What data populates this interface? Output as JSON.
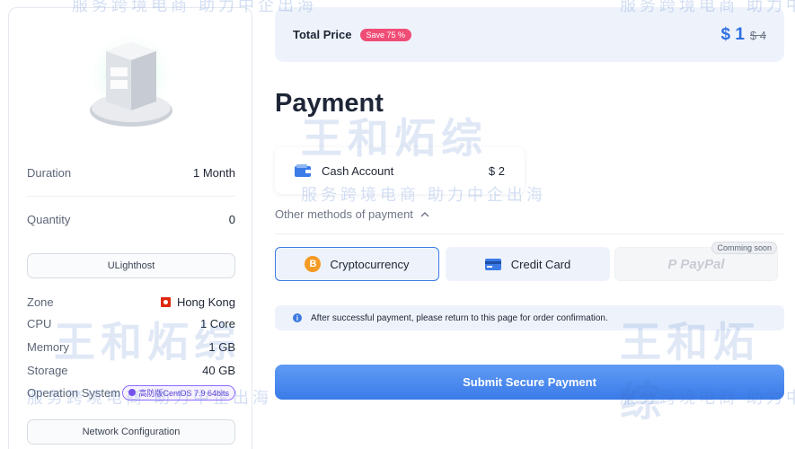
{
  "summary": {
    "rows": [
      {
        "label": "Duration",
        "value": "1 Month"
      },
      {
        "label": "Quantity",
        "value": "0"
      }
    ],
    "ulighthost_label": "ULighthost",
    "specs": [
      {
        "label": "Zone",
        "value": "Hong Kong"
      },
      {
        "label": "CPU",
        "value": "1 Core"
      },
      {
        "label": "Memory",
        "value": "1 GB"
      },
      {
        "label": "Storage",
        "value": "40 GB"
      },
      {
        "label": "Operation System",
        "value": "高防版CentOS 7.9 64bits"
      }
    ],
    "network_button": "Network Configuration"
  },
  "total": {
    "label": "Total Price",
    "badge": "Save 75 %",
    "price_new": "$ 1",
    "price_old": "$ 4"
  },
  "payment": {
    "title": "Payment",
    "cash_label": "Cash Account",
    "cash_amount": "$ 2",
    "other_methods": "Other methods of payment",
    "methods": [
      {
        "label": "Cryptocurrency"
      },
      {
        "label": "Credit Card"
      },
      {
        "label": "PayPal",
        "badge": "Comming soon"
      }
    ],
    "notice": "After successful payment, please return to this page for order confirmation.",
    "submit": "Submit Secure Payment"
  },
  "watermark": {
    "tagline": "服务跨境电商 助力中企出海",
    "brand": "王和炻综"
  },
  "colors": {
    "accent": "#3b7be8",
    "badge": "#f04d76",
    "panel": "#eef3fb"
  }
}
